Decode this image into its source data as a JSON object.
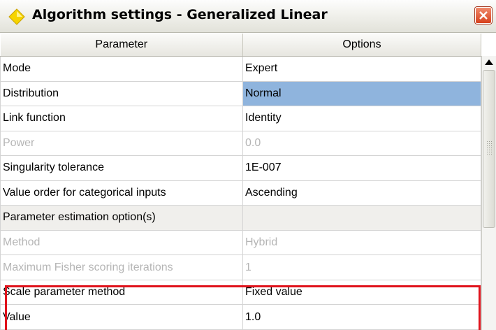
{
  "window": {
    "title": "Algorithm settings - Generalized Linear",
    "app_icon": "diamond-icon",
    "close_icon": "close-icon"
  },
  "grid": {
    "headers": {
      "parameter": "Parameter",
      "options": "Options"
    },
    "rows": [
      {
        "parameter": "Mode",
        "option": "Expert",
        "state": "normal"
      },
      {
        "parameter": "Distribution",
        "option": "Normal",
        "state": "selected"
      },
      {
        "parameter": "Link function",
        "option": "Identity",
        "state": "normal"
      },
      {
        "parameter": "Power",
        "option": "0.0",
        "state": "disabled"
      },
      {
        "parameter": "Singularity tolerance",
        "option": "1E-007",
        "state": "normal"
      },
      {
        "parameter": "Value order for categorical inputs",
        "option": "Ascending",
        "state": "normal"
      },
      {
        "parameter": "Parameter estimation option(s)",
        "option": "",
        "state": "section"
      },
      {
        "parameter": "Method",
        "option": "Hybrid",
        "state": "disabled"
      },
      {
        "parameter": "Maximum Fisher scoring iterations",
        "option": "1",
        "state": "disabled"
      },
      {
        "parameter": "Scale parameter method",
        "option": "Fixed value",
        "state": "highlighted"
      },
      {
        "parameter": "Value",
        "option": "1.0",
        "state": "highlighted"
      }
    ]
  },
  "colors": {
    "selection": "#8fb4dd",
    "highlight_border": "#e0121b",
    "disabled_text": "#b5b5b5"
  }
}
